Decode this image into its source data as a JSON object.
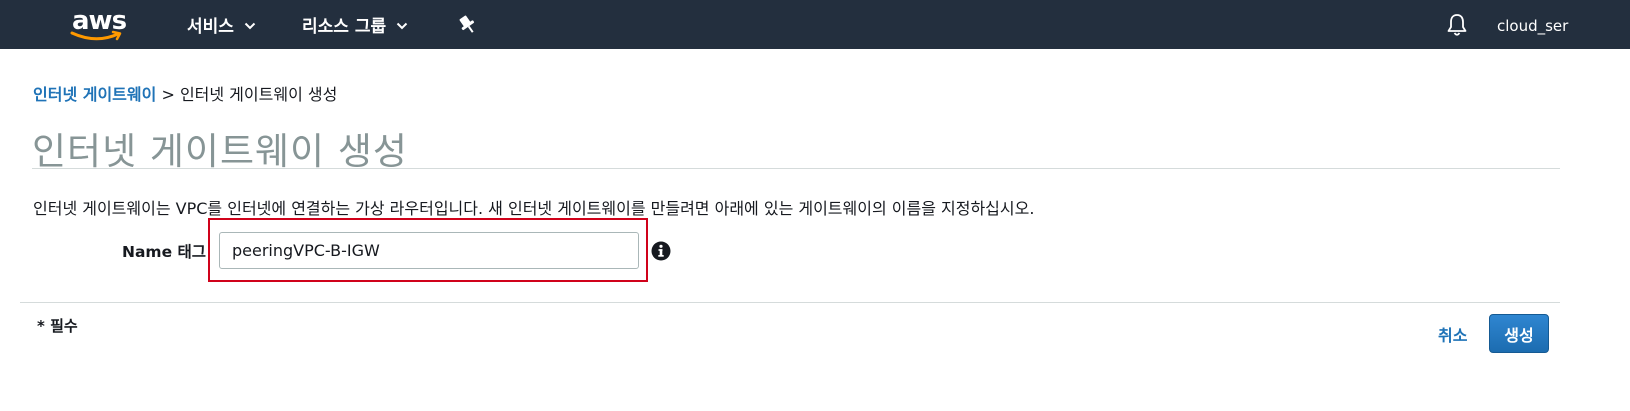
{
  "topbar": {
    "logo_text": "aws",
    "nav": {
      "services_label": "서비스",
      "resource_groups_label": "리소스 그룹"
    },
    "user_label": "cloud_ser"
  },
  "breadcrumb": {
    "parent_label": "인터넷 게이트웨이",
    "separator": ">",
    "current_label": "인터넷 게이트웨이 생성"
  },
  "page": {
    "title": "인터넷 게이트웨이 생성",
    "description": "인터넷 게이트웨이는 VPC를 인터넷에 연결하는 가상 라우터입니다. 새 인터넷 게이트웨이를 만들려면 아래에 있는 게이트웨이의 이름을 지정하십시오."
  },
  "form": {
    "name_tag_label": "Name 태그",
    "name_tag_value": "peeringVPC-B-IGW"
  },
  "footer": {
    "required_note": "* 필수",
    "cancel_label": "취소",
    "create_label": "생성"
  },
  "icons": {
    "chevron": "chevron-down-icon",
    "pin": "pin-icon",
    "bell": "bell-icon",
    "info": "info-icon"
  },
  "colors": {
    "topbar_bg": "#232f3e",
    "link_blue": "#1f73b7",
    "highlight_red": "#d0021b",
    "title_gray": "#879596",
    "logo_smile": "#ff9900"
  }
}
